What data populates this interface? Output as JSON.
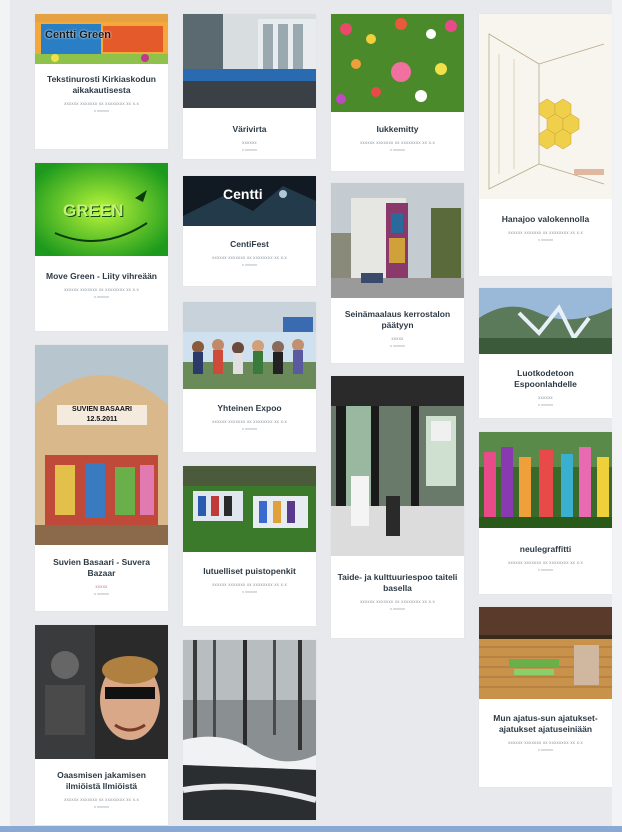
{
  "cards": [
    {
      "title": "Tekstinurosti Kirkiaskodun aikakautisesta",
      "meta": "xxxxxx xxxxxxx xx xxxxxxxx xx x.x",
      "date": "x xxxxxx",
      "overlay": "Centti Green"
    },
    {
      "title": "Move Green - Liity vihreään",
      "meta": "xxxxxx xxxxxxx xx xxxxxxxx xx x.x",
      "date": "x xxxxxx",
      "overlay": "GREEN"
    },
    {
      "title": "Suvien Basaari - Suvera Bazaar",
      "meta": "xxxxx",
      "date": "x xxxxxx",
      "overlay": "SUVIEN BASAARI 12.5.2011"
    },
    {
      "title": "Oaasmisen jakamisen ilmiöistä Ilmiöistä",
      "meta": "xxxxxx xxxxxxx xx xxxxxxxx xx x.x",
      "date": "x xxxxxx"
    },
    {
      "title": "Värivirta",
      "meta": "xxxxxx",
      "date": "x xxxxxx"
    },
    {
      "title": "CentiFest",
      "meta": "xxxxxx xxxxxxx xx xxxxxxxx xx x.x",
      "date": "x xxxxxx",
      "overlay": "Centti"
    },
    {
      "title": "Yhteinen Expoo",
      "meta": "xxxxxx xxxxxxx xx xxxxxxxx xx x.x",
      "date": "x xxxxxx"
    },
    {
      "title": "Iutuelliset puistopenkit",
      "meta": "xxxxxx xxxxxxx xx xxxxxxxx xx x.x",
      "date": "x xxxxxx"
    },
    {
      "title": "Iukkemitty",
      "meta": "xxxxxx xxxxxxx xx xxxxxxxx xx x.x",
      "date": "x xxxxxx"
    },
    {
      "title": "Seinämaalaus kerrostalon päätyyn",
      "meta": "xxxxx",
      "date": "x xxxxxx"
    },
    {
      "title": "Taide- ja kulttuuriespoo taiteli basella",
      "meta": "xxxxxx xxxxxxx xx xxxxxxxx xx x.x",
      "date": "x xxxxxx"
    },
    {
      "title": "Hanajoo valokennolla",
      "meta": "xxxxxx xxxxxxx xx xxxxxxxx xx x.x",
      "date": "x xxxxxx"
    },
    {
      "title": "Luotkodetoon Espoonlahdelle",
      "meta": "xxxxxx",
      "date": "x xxxxxx"
    },
    {
      "title": "neulegraffitti",
      "meta": "xxxxxx xxxxxxx xx xxxxxxxx xx x.x",
      "date": "x xxxxxx"
    },
    {
      "title": "Mun ajatus-sun ajatukset-ajatukset ajatuseiniään",
      "meta": "xxxxxx xxxxxxx xx xxxxxxxx xx x.x",
      "date": "x xxxxxx"
    }
  ]
}
